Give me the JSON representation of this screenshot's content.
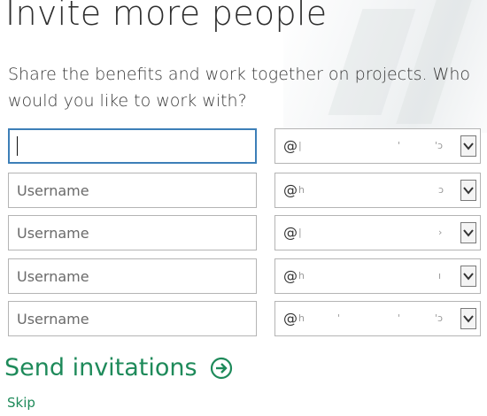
{
  "page": {
    "title": "Invite more people",
    "description": "Share the benefits and work together on projects. Who would you like to work with?"
  },
  "invites": [
    {
      "username_value": "",
      "username_placeholder": "",
      "domain_prefix": "@",
      "focused": true
    },
    {
      "username_value": "",
      "username_placeholder": "Username",
      "domain_prefix": "@",
      "focused": false
    },
    {
      "username_value": "",
      "username_placeholder": "Username",
      "domain_prefix": "@",
      "focused": false
    },
    {
      "username_value": "",
      "username_placeholder": "Username",
      "domain_prefix": "@",
      "focused": false
    },
    {
      "username_value": "",
      "username_placeholder": "Username",
      "domain_prefix": "@",
      "focused": false
    }
  ],
  "actions": {
    "send_label": "Send invitations",
    "send_icon": "arrow-right-circle-icon",
    "skip_label": "Skip"
  },
  "colors": {
    "accent_green": "#1e8a5a",
    "focus_blue": "#3d7fb8"
  }
}
